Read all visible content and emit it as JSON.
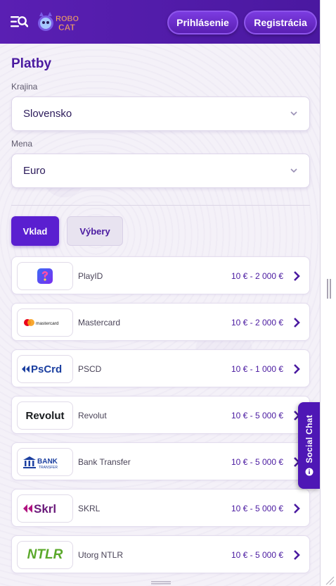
{
  "header": {
    "login_label": "Prihlásenie",
    "register_label": "Registrácia",
    "logo_top": "ROBO",
    "logo_bottom": "CAT"
  },
  "page": {
    "title": "Platby",
    "country_label": "Krajina",
    "country_value": "Slovensko",
    "currency_label": "Mena",
    "currency_value": "Euro"
  },
  "tabs": {
    "deposit": "Vklad",
    "withdrawals": "Výbery"
  },
  "methods": [
    {
      "name": "PlayID",
      "range": "10 € - 2 000 €",
      "logo": "playid"
    },
    {
      "name": "Mastercard",
      "range": "10 € - 2 000 €",
      "logo": "mastercard",
      "logo_text": "mastercard"
    },
    {
      "name": "PSCD",
      "range": "10 € - 1 000 €",
      "logo": "pscd",
      "logo_text": "PsCrd"
    },
    {
      "name": "Revolut",
      "range": "10 € - 5 000 €",
      "logo": "revolut",
      "logo_text": "Revolut"
    },
    {
      "name": "Bank Transfer",
      "range": "10 € - 5 000 €",
      "logo": "bank",
      "logo_text": "BANK",
      "logo_sub": "TRANSFER"
    },
    {
      "name": "SKRL",
      "range": "10 € - 5 000 €",
      "logo": "skrl",
      "logo_text": "Skrl"
    },
    {
      "name": "Utorg NTLR",
      "range": "10 € - 5 000 €",
      "logo": "ntlr",
      "logo_text": "NTLR"
    }
  ],
  "social_chat": {
    "label": "Social Chat",
    "icon": "info-icon"
  },
  "colors": {
    "brand_purple": "#5a1fb3",
    "accent_violet": "#5a1fd0",
    "text_purple": "#4a1aa0"
  }
}
